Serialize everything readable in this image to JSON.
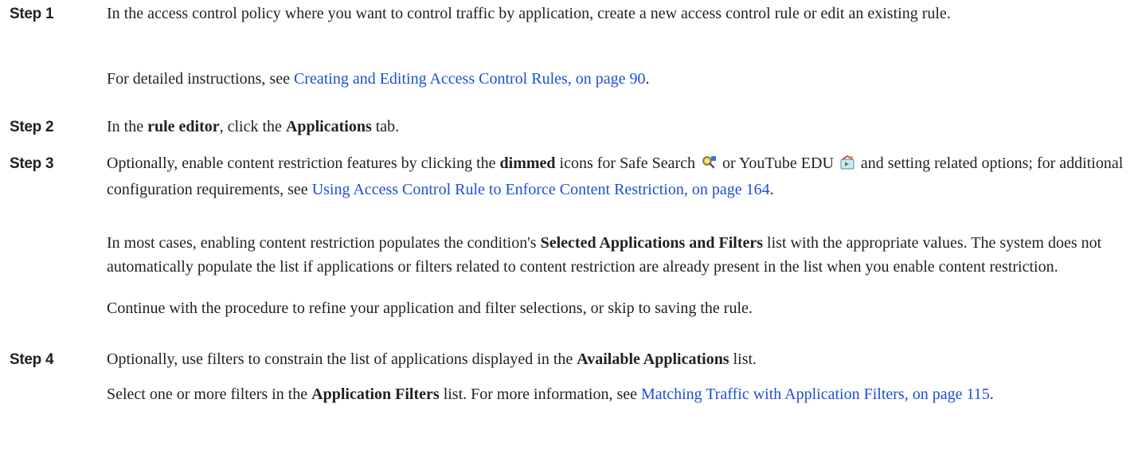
{
  "steps": [
    {
      "label": "Step 1",
      "p1": {
        "text": "In the access control policy where you want to control traffic by application, create a new access control rule or edit an existing rule."
      },
      "p2": {
        "prefix": "For detailed instructions, see ",
        "link": "Creating and Editing Access Control Rules, on page 90",
        "suffix": "."
      }
    },
    {
      "label": "Step 2",
      "p1": {
        "t1": "In the ",
        "b1": "rule editor",
        "t2": ", click the ",
        "b2": "Applications",
        "t3": " tab."
      }
    },
    {
      "label": "Step 3",
      "p1": {
        "t1": "Optionally, enable content restriction features by clicking the ",
        "b1": "dimmed",
        "t2": " icons for Safe Search ",
        "t3": " or YouTube EDU ",
        "t4": " and setting related options; for additional configuration requirements, see ",
        "link": "Using Access Control Rule to Enforce Content Restriction, on page 164",
        "t5": "."
      },
      "p2": {
        "t1": "In most cases, enabling content restriction populates the condition's ",
        "b1": "Selected Applications and Filters",
        "t2": " list with the appropriate values. The system does not automatically populate the list if applications or filters related to content restriction are already present in the list when you enable content restriction."
      },
      "p3": {
        "text": "Continue with the procedure to refine your application and filter selections, or skip to saving the rule."
      }
    },
    {
      "label": "Step 4",
      "p1": {
        "t1": "Optionally, use filters to constrain the list of applications displayed in the ",
        "b1": "Available Applications",
        "t2": " list."
      },
      "p2": {
        "t1": "Select one or more filters in the ",
        "b1": "Application Filters",
        "t2": " list. For more information, see ",
        "link": "Matching Traffic with Application Filters, on page 115",
        "t3": "."
      }
    }
  ],
  "icons": {
    "safe_search": "safe-search-icon",
    "youtube_edu": "youtube-edu-icon"
  },
  "colors": {
    "text": "#231f20",
    "link": "#1f4fd1"
  }
}
